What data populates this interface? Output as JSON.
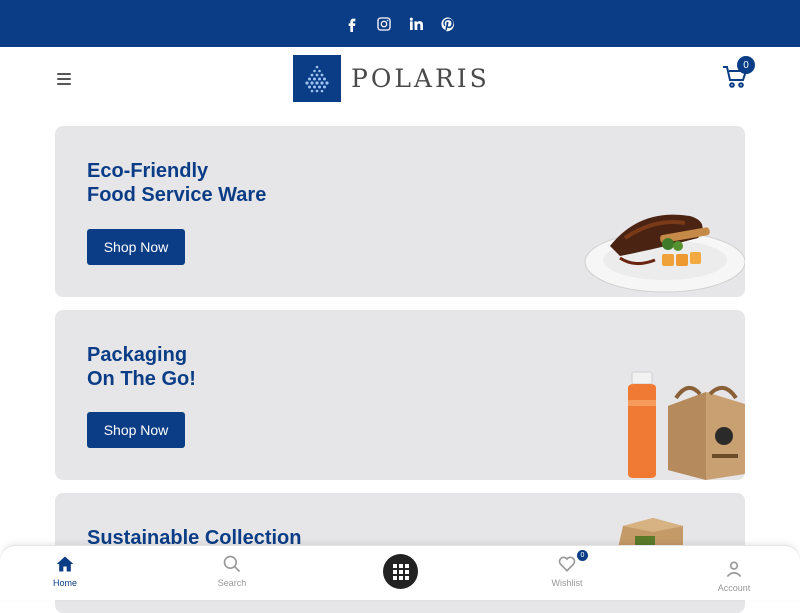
{
  "topbar": {
    "social_icons": [
      "facebook-icon",
      "instagram-icon",
      "linkedin-icon",
      "pinterest-icon"
    ],
    "bg_color": "#0b3d86"
  },
  "header": {
    "logo_text": "POLARIS",
    "cart_count": "0"
  },
  "banners": [
    {
      "title_line1": "Eco-Friendly",
      "title_line2": "Food Service Ware",
      "button": "Shop Now"
    },
    {
      "title_line1": "Packaging",
      "title_line2": "On The Go!",
      "button": "Shop Now"
    },
    {
      "title_line1": "Sustainable Collection"
    }
  ],
  "bottom_nav": {
    "home": "Home",
    "search": "Search",
    "wishlist": "Wishlist",
    "wishlist_count": "0",
    "account": "Account"
  },
  "colors": {
    "brand": "#0b3d86",
    "banner_bg": "#e6e6e8"
  }
}
